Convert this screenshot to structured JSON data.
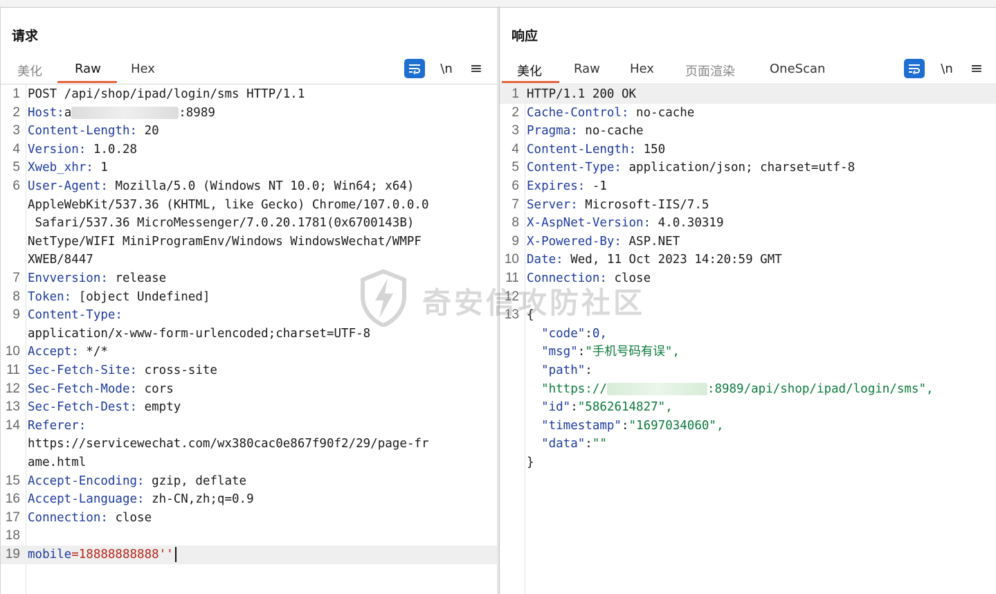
{
  "request": {
    "title": "请求",
    "tabs": [
      "美化",
      "Raw",
      "Hex"
    ],
    "active_tab": "Raw",
    "icons": [
      "wrap-icon",
      "newline-icon",
      "menu-icon"
    ],
    "newline_label": "\\n",
    "menu_glyph": "≡",
    "lines": [
      {
        "n": "1",
        "t": "POST /api/shop/ipad/login/sms HTTP/1.1"
      },
      {
        "n": "2",
        "k": "Host:",
        "v": "a",
        "blur": true,
        "v2": ":8989"
      },
      {
        "n": "3",
        "k": "Content-Length:",
        "v": " 20"
      },
      {
        "n": "4",
        "k": "Version:",
        "v": " 1.0.28"
      },
      {
        "n": "5",
        "k": "Xweb_xhr:",
        "v": " 1"
      },
      {
        "n": "6",
        "k": "User-Agent:",
        "v": " Mozilla/5.0 (Windows NT 10.0; Win64; x64)"
      },
      {
        "n": "",
        "t": "AppleWebKit/537.36 (KHTML, like Gecko) Chrome/107.0.0.0"
      },
      {
        "n": "",
        "t": " Safari/537.36 MicroMessenger/7.0.20.1781(0x6700143B)"
      },
      {
        "n": "",
        "t": "NetType/WIFI MiniProgramEnv/Windows WindowsWechat/WMPF"
      },
      {
        "n": "",
        "t": "XWEB/8447"
      },
      {
        "n": "7",
        "k": "Envversion:",
        "v": " release"
      },
      {
        "n": "8",
        "k": "Token:",
        "v": " [object Undefined]"
      },
      {
        "n": "9",
        "k": "Content-Type:",
        "v": ""
      },
      {
        "n": "",
        "t": "application/x-www-form-urlencoded;charset=UTF-8"
      },
      {
        "n": "10",
        "k": "Accept:",
        "v": " */*"
      },
      {
        "n": "11",
        "k": "Sec-Fetch-Site:",
        "v": " cross-site"
      },
      {
        "n": "12",
        "k": "Sec-Fetch-Mode:",
        "v": " cors"
      },
      {
        "n": "13",
        "k": "Sec-Fetch-Dest:",
        "v": " empty"
      },
      {
        "n": "14",
        "k": "Referer:",
        "v": ""
      },
      {
        "n": "",
        "t": "https://servicewechat.com/wx380cac0e867f90f2/29/page-fr"
      },
      {
        "n": "",
        "t": "ame.html"
      },
      {
        "n": "15",
        "k": "Accept-Encoding:",
        "v": " gzip, deflate"
      },
      {
        "n": "16",
        "k": "Accept-Language:",
        "v": " zh-CN,zh;q=0.9"
      },
      {
        "n": "17",
        "k": "Connection:",
        "v": " close"
      },
      {
        "n": "18",
        "t": ""
      },
      {
        "n": "19",
        "body_k": "mobile",
        "body_v": "=18888888888''",
        "caret": true,
        "highlight": true
      }
    ]
  },
  "response": {
    "title": "响应",
    "tabs": [
      "美化",
      "Raw",
      "Hex",
      "页面渲染",
      "OneScan"
    ],
    "active_tab": "美化",
    "icons": [
      "wrap-icon",
      "newline-icon",
      "menu-icon"
    ],
    "newline_label": "\\n",
    "menu_glyph": "≡",
    "lines": [
      {
        "n": "1",
        "t": "HTTP/1.1 200 OK",
        "highlight": true
      },
      {
        "n": "2",
        "k": "Cache-Control:",
        "v": " no-cache"
      },
      {
        "n": "3",
        "k": "Pragma:",
        "v": " no-cache"
      },
      {
        "n": "4",
        "k": "Content-Length:",
        "v": " 150"
      },
      {
        "n": "5",
        "k": "Content-Type:",
        "v": " application/json; charset=utf-8"
      },
      {
        "n": "6",
        "k": "Expires:",
        "v": " -1"
      },
      {
        "n": "7",
        "k": "Server:",
        "v": " Microsoft-IIS/7.5"
      },
      {
        "n": "8",
        "k": "X-AspNet-Version:",
        "v": " 4.0.30319"
      },
      {
        "n": "9",
        "k": "X-Powered-By:",
        "v": " ASP.NET"
      },
      {
        "n": "10",
        "k": "Date:",
        "v": " Wed, 11 Oct 2023 14:20:59 GMT"
      },
      {
        "n": "11",
        "k": "Connection:",
        "v": " close"
      },
      {
        "n": "12",
        "t": ""
      },
      {
        "n": "13",
        "t": "{"
      },
      {
        "n": "",
        "jk": "  \"code\"",
        "sep": ":",
        "jv": "0,",
        "num": true
      },
      {
        "n": "",
        "jk": "  \"msg\"",
        "sep": ":",
        "jv": "\"手机号码有误\","
      },
      {
        "n": "",
        "jk": "  \"path\"",
        "sep": ":",
        "jv": ""
      },
      {
        "n": "",
        "jv_pre": "  \"https://",
        "blur": true,
        "jv": ":8989/api/shop/ipad/login/sms\","
      },
      {
        "n": "",
        "jk": "  \"id\"",
        "sep": ":",
        "jv": "\"5862614827\","
      },
      {
        "n": "",
        "jk": "  \"timestamp\"",
        "sep": ":",
        "jv": "\"1697034060\","
      },
      {
        "n": "",
        "jk": "  \"data\"",
        "sep": ":",
        "jv": "\"\""
      },
      {
        "n": "",
        "t": "}"
      }
    ]
  },
  "layout_buttons": [
    "split-horizontal-icon",
    "split-vertical-icon",
    "single-pane-icon"
  ],
  "watermark_text": "奇安信攻防社区",
  "colors": {
    "accent": "#e8623a",
    "header_key": "#1d3a9e",
    "json_string": "#0a7a3a",
    "button_blue": "#1f6fd1"
  }
}
